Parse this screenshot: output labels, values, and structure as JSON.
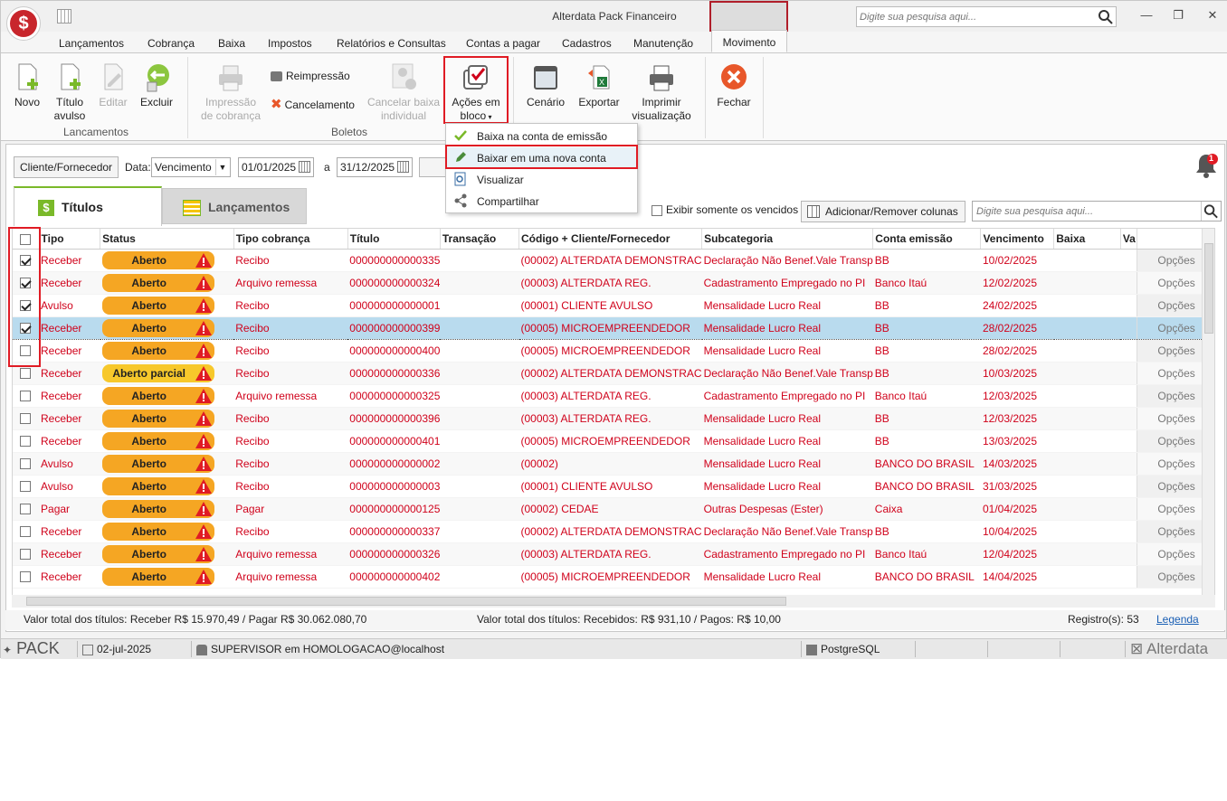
{
  "app": {
    "title": "Alterdata Pack Financeiro",
    "search_placeholder": "Digite sua pesquisa aqui..."
  },
  "menu": {
    "tabs": [
      "Lançamentos",
      "Cobrança",
      "Baixa",
      "Impostos",
      "Relatórios e Consultas",
      "Contas a pagar",
      "Cadastros",
      "Manutenção",
      "Movimento"
    ]
  },
  "ribbon": {
    "novo": "Novo",
    "titulo_avulso_1": "Título",
    "titulo_avulso_2": "avulso",
    "editar": "Editar",
    "excluir": "Excluir",
    "group_lancamentos": "Lancamentos",
    "impressao_1": "Impressão",
    "impressao_2": "de cobrança",
    "reimpressao": "Reimpressão",
    "cancelamento": "Cancelamento",
    "cancelar_1": "Cancelar baixa",
    "cancelar_2": "individual",
    "group_boletos": "Boletos",
    "acoes_1": "Ações em",
    "acoes_2": "bloco",
    "cenario": "Cenário",
    "exportar": "Exportar",
    "imprimir_1": "Imprimir",
    "imprimir_2": "visualização",
    "fechar": "Fechar"
  },
  "dropdown": {
    "items": [
      "Baixa na conta de emissão",
      "Baixar em uma nova conta",
      "Visualizar",
      "Compartilhar"
    ]
  },
  "filters": {
    "cliente_btn": "Cliente/Fornecedor",
    "data_label": "Data:",
    "data_value": "Vencimento",
    "date_from": "01/01/2025",
    "a_label": "a",
    "date_to": "31/12/2025",
    "vencidos_label": "Exibir somente os vencidos",
    "colunas_btn": "Adicionar/Remover colunas",
    "search_placeholder": "Digite sua pesquisa aqui...",
    "notif_count": "1"
  },
  "tabs": {
    "titulos": "Títulos",
    "lancamentos": "Lançamentos"
  },
  "grid": {
    "columns": [
      "Tipo",
      "Status",
      "Tipo cobrança",
      "Título",
      "Transação",
      "Código + Cliente/Fornecedor",
      "Subcategoria",
      "Conta emissão",
      "Vencimento",
      "Baixa",
      "Va"
    ],
    "options_label": "Opções",
    "rows": [
      {
        "checked": true,
        "tipo": "Receber",
        "status": "Aberto",
        "cobranca": "Recibo",
        "titulo": "000000000000335",
        "cliente": "(00002) ALTERDATA DEMONSTRAC",
        "sub": "Declaração Não Benef.Vale Transp",
        "conta": "BB",
        "venc": "10/02/2025"
      },
      {
        "checked": true,
        "tipo": "Receber",
        "status": "Aberto",
        "cobranca": "Arquivo remessa",
        "titulo": "000000000000324",
        "cliente": "(00003) ALTERDATA REG.",
        "sub": "Cadastramento Empregado no PI",
        "conta": "Banco Itaú",
        "venc": "12/02/2025"
      },
      {
        "checked": true,
        "tipo": "Avulso",
        "status": "Aberto",
        "cobranca": "Recibo",
        "titulo": "000000000000001",
        "cliente": "(00001) CLIENTE AVULSO",
        "sub": "Mensalidade Lucro Real",
        "conta": "BB",
        "venc": "24/02/2025"
      },
      {
        "checked": true,
        "tipo": "Receber",
        "status": "Aberto",
        "cobranca": "Recibo",
        "titulo": "000000000000399",
        "cliente": "(00005) MICROEMPREENDEDOR",
        "sub": "Mensalidade Lucro Real",
        "conta": "BB",
        "venc": "28/02/2025",
        "selected": true
      },
      {
        "checked": false,
        "tipo": "Receber",
        "status": "Aberto",
        "cobranca": "Recibo",
        "titulo": "000000000000400",
        "cliente": "(00005) MICROEMPREENDEDOR",
        "sub": "Mensalidade Lucro Real",
        "conta": "BB",
        "venc": "28/02/2025"
      },
      {
        "checked": false,
        "tipo": "Receber",
        "status": "Aberto parcial",
        "cobranca": "Recibo",
        "titulo": "000000000000336",
        "cliente": "(00002) ALTERDATA DEMONSTRAC",
        "sub": "Declaração Não Benef.Vale Transp",
        "conta": "BB",
        "venc": "10/03/2025"
      },
      {
        "checked": false,
        "tipo": "Receber",
        "status": "Aberto",
        "cobranca": "Arquivo remessa",
        "titulo": "000000000000325",
        "cliente": "(00003) ALTERDATA REG.",
        "sub": "Cadastramento Empregado no PI",
        "conta": "Banco Itaú",
        "venc": "12/03/2025"
      },
      {
        "checked": false,
        "tipo": "Receber",
        "status": "Aberto",
        "cobranca": "Recibo",
        "titulo": "000000000000396",
        "cliente": "(00003) ALTERDATA REG.",
        "sub": "Mensalidade Lucro Real",
        "conta": "BB",
        "venc": "12/03/2025"
      },
      {
        "checked": false,
        "tipo": "Receber",
        "status": "Aberto",
        "cobranca": "Recibo",
        "titulo": "000000000000401",
        "cliente": "(00005) MICROEMPREENDEDOR",
        "sub": "Mensalidade Lucro Real",
        "conta": "BB",
        "venc": "13/03/2025"
      },
      {
        "checked": false,
        "tipo": "Avulso",
        "status": "Aberto",
        "cobranca": "Recibo",
        "titulo": "000000000000002",
        "cliente": "(00002)",
        "sub": "Mensalidade Lucro Real",
        "conta": "BANCO DO BRASIL",
        "venc": "14/03/2025"
      },
      {
        "checked": false,
        "tipo": "Avulso",
        "status": "Aberto",
        "cobranca": "Recibo",
        "titulo": "000000000000003",
        "cliente": "(00001) CLIENTE AVULSO",
        "sub": "Mensalidade Lucro Real",
        "conta": "BANCO DO BRASIL",
        "venc": "31/03/2025"
      },
      {
        "checked": false,
        "tipo": "Pagar",
        "status": "Aberto",
        "cobranca": "Pagar",
        "titulo": "000000000000125",
        "cliente": "(00002) CEDAE",
        "sub": "Outras Despesas (Ester)",
        "conta": "Caixa",
        "venc": "01/04/2025"
      },
      {
        "checked": false,
        "tipo": "Receber",
        "status": "Aberto",
        "cobranca": "Recibo",
        "titulo": "000000000000337",
        "cliente": "(00002) ALTERDATA DEMONSTRAC",
        "sub": "Declaração Não Benef.Vale Transp",
        "conta": "BB",
        "venc": "10/04/2025"
      },
      {
        "checked": false,
        "tipo": "Receber",
        "status": "Aberto",
        "cobranca": "Arquivo remessa",
        "titulo": "000000000000326",
        "cliente": "(00003) ALTERDATA REG.",
        "sub": "Cadastramento Empregado no PI",
        "conta": "Banco Itaú",
        "venc": "12/04/2025"
      },
      {
        "checked": false,
        "tipo": "Receber",
        "status": "Aberto",
        "cobranca": "Arquivo remessa",
        "titulo": "000000000000402",
        "cliente": "(00005) MICROEMPREENDEDOR",
        "sub": "Mensalidade Lucro Real",
        "conta": "BANCO DO BRASIL",
        "venc": "14/04/2025"
      }
    ]
  },
  "summary": {
    "left": "Valor total dos títulos: Receber R$ 15.970,49 / Pagar R$ 30.062.080,70",
    "mid": "Valor total dos títulos: Recebidos: R$ 931,10 / Pagos: R$ 10,00",
    "registros": "Registro(s): 53",
    "legenda": "Legenda"
  },
  "statusbar": {
    "pack": "PACK",
    "date": "02-jul-2025",
    "user": "SUPERVISOR em HOMOLOGACAO@localhost",
    "db": "PostgreSQL",
    "brand": "Alterdata"
  },
  "colors": {
    "accent_red": "#e01b24",
    "row_text": "#d0021b",
    "status_orange": "#f5a623",
    "selected_row": "#b9dbee"
  }
}
